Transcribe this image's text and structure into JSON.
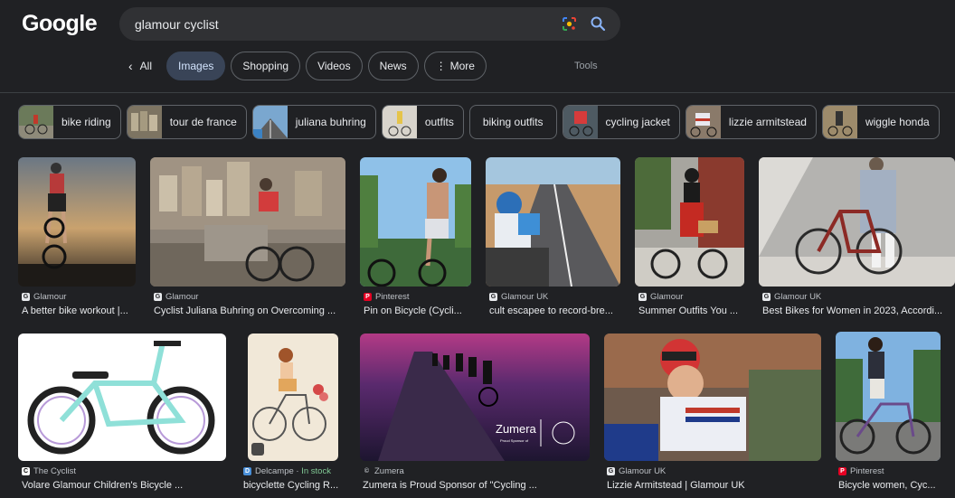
{
  "header": {
    "logo": "Google",
    "search_value": "glamour cyclist"
  },
  "tabs": [
    {
      "label": "All"
    },
    {
      "label": "Images"
    },
    {
      "label": "Shopping"
    },
    {
      "label": "Videos"
    },
    {
      "label": "News"
    },
    {
      "label": "More"
    }
  ],
  "tools_label": "Tools",
  "chips": [
    {
      "label": "bike riding"
    },
    {
      "label": "tour de france"
    },
    {
      "label": "juliana buhring"
    },
    {
      "label": "outfits"
    },
    {
      "label": "biking outfits"
    },
    {
      "label": "cycling jacket"
    },
    {
      "label": "lizzie armitstead"
    },
    {
      "label": "wiggle honda"
    }
  ],
  "results": [
    {
      "source": "Glamour",
      "caption": "A better bike workout |..."
    },
    {
      "source": "Glamour",
      "caption": "Cyclist Juliana Buhring on Overcoming ..."
    },
    {
      "source": "Pinterest",
      "caption": "Pin on Bicycle (Cycli..."
    },
    {
      "source": "Glamour UK",
      "caption": "cult escapee to record-bre..."
    },
    {
      "source": "Glamour",
      "caption": "Summer Outfits You ..."
    },
    {
      "source": "Glamour UK",
      "caption": "Best Bikes for Women in 2023, Accordi..."
    },
    {
      "source": "The Cyclist",
      "caption": "Volare Glamour Children's Bicycle ..."
    },
    {
      "source": "Delcampe",
      "stock": "In stock",
      "caption": "bicyclette Cycling R..."
    },
    {
      "source": "Zumera",
      "caption": "Zumera is Proud Sponsor of \"Cycling ...",
      "overlay_brand": "Zumera",
      "overlay_sub": "Proud Sponsor of"
    },
    {
      "source": "Glamour UK",
      "caption": "Lizzie Armitstead | Glamour UK"
    },
    {
      "source": "Pinterest",
      "caption": "Bicycle women, Cyc..."
    }
  ],
  "colors": {
    "background": "#202124",
    "searchbox": "#303134",
    "active_tab": "#394457",
    "stock_green": "#81c995"
  }
}
